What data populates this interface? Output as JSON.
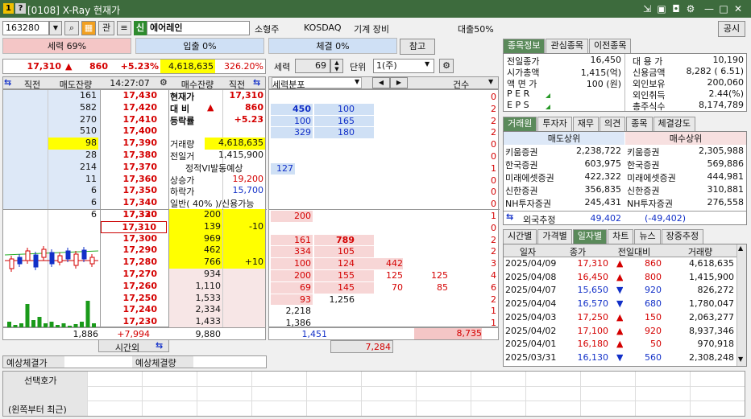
{
  "window": {
    "title": "[0108] X-Ray 현재가",
    "icon_num": "1",
    "icon_help": "?"
  },
  "toolbar": {
    "code": "163280",
    "btn_kwan": "관",
    "btn_sin": "신",
    "stock_name": "에어레인",
    "size": "소형주",
    "market": "KOSDAQ",
    "sector": "기계 장비",
    "loan": "대출50%",
    "notice": "공시"
  },
  "strength": {
    "label": "세력 69%",
    "in_label": "입출 0%",
    "trade_label": "체결 0%",
    "ref_btn": "참고"
  },
  "price_bar": {
    "price": "17,310",
    "arrow": "▲",
    "change": "860",
    "rate": "+5.23%",
    "volume": "4,618,635",
    "vol_rate": "326.20%"
  },
  "controls": {
    "force_label": "세력",
    "force_value": "69",
    "unit_label": "단위",
    "unit_value": "1(주)"
  },
  "orderbook_header": {
    "left_arrow": "⇆",
    "col1": "직전",
    "col2": "매도잔량",
    "time": "14:27:07",
    "col3": "매수잔량",
    "col4": "직전"
  },
  "ask_rows": [
    {
      "qty": "161",
      "price": "17,430"
    },
    {
      "qty": "582",
      "price": "17,420"
    },
    {
      "qty": "270",
      "price": "17,410"
    },
    {
      "qty": "510",
      "price": "17,400"
    },
    {
      "qty": "98",
      "price": "17,390"
    },
    {
      "qty": "28",
      "price": "17,380"
    },
    {
      "qty": "214",
      "price": "17,370"
    },
    {
      "qty": "11",
      "price": "17,360"
    },
    {
      "qty": "6",
      "price": "17,350"
    },
    {
      "qty": "6",
      "price": "17,340"
    },
    {
      "qty": "6",
      "price": "17,330"
    }
  ],
  "info_rows": [
    {
      "label": "현재가",
      "value": "17,310"
    },
    {
      "label": "대  비",
      "arrow": "▲",
      "value": "860"
    },
    {
      "label": "등락률",
      "value": "+5.23"
    },
    {
      "label": "",
      "value": ""
    },
    {
      "label": "거래량",
      "value": "4,618,635"
    },
    {
      "label": "전일거",
      "value": "1,415,900"
    },
    {
      "label": "정적VI발동예상",
      "value": ""
    },
    {
      "label": "상승가",
      "value": "19,200"
    },
    {
      "label": "하락가",
      "value": "15,700"
    },
    {
      "label": "일반( 40% )/신용가능",
      "value": ""
    }
  ],
  "bid_rows": [
    {
      "price": "17,320",
      "qty": "200",
      "prev": ""
    },
    {
      "price": "17,310",
      "qty": "139",
      "prev": "-10"
    },
    {
      "price": "17,300",
      "qty": "969",
      "prev": ""
    },
    {
      "price": "17,290",
      "qty": "462",
      "prev": ""
    },
    {
      "price": "17,280",
      "qty": "766",
      "prev": "+10"
    },
    {
      "price": "17,270",
      "qty": "934",
      "prev": ""
    },
    {
      "price": "17,260",
      "qty": "1,110",
      "prev": ""
    },
    {
      "price": "17,250",
      "qty": "1,533",
      "prev": ""
    },
    {
      "price": "17,240",
      "qty": "2,334",
      "prev": ""
    },
    {
      "price": "17,230",
      "qty": "1,433",
      "prev": ""
    }
  ],
  "orderbook_total": {
    "ask_total": "1,886",
    "diff": "+7,994",
    "bid_total": "9,880",
    "after_hours": "시간외"
  },
  "force_panel": {
    "header": "세력분포",
    "count_header": "건수",
    "ask_rows": [
      {
        "a": "",
        "b": "",
        "cnt": "0"
      },
      {
        "a": "450",
        "b": "100",
        "cnt": "2"
      },
      {
        "a": "100",
        "b": "165",
        "cnt": "2"
      },
      {
        "a": "329",
        "b": "180",
        "cnt": "2"
      },
      {
        "a": "",
        "b": "",
        "cnt": "0"
      },
      {
        "a": "",
        "b": "",
        "cnt": "0"
      },
      {
        "a": "127",
        "b": "",
        "cnt": "1"
      },
      {
        "a": "",
        "b": "",
        "cnt": "0"
      },
      {
        "a": "",
        "b": "",
        "cnt": "0"
      },
      {
        "a": "",
        "b": "",
        "cnt": "0"
      }
    ],
    "bid_rows": [
      {
        "a": "200",
        "b": "",
        "c": "",
        "d": "",
        "cnt": "1"
      },
      {
        "a": "",
        "b": "",
        "c": "",
        "d": "",
        "cnt": "0"
      },
      {
        "a": "161",
        "b": "789",
        "c": "",
        "d": "",
        "cnt": "2"
      },
      {
        "a": "334",
        "b": "105",
        "c": "",
        "d": "",
        "cnt": "2"
      },
      {
        "a": "100",
        "b": "124",
        "c": "442",
        "d": "",
        "cnt": "3"
      },
      {
        "a": "200",
        "b": "155",
        "c": "125",
        "d": "125",
        "cnt": "4"
      },
      {
        "a": "69",
        "b": "145",
        "c": "70",
        "d": "85",
        "cnt": "6"
      },
      {
        "a": "93",
        "b": "1,256",
        "c": "",
        "d": "",
        "cnt": "2"
      },
      {
        "a": "2,218",
        "b": "",
        "c": "",
        "d": "",
        "cnt": "1"
      },
      {
        "a": "1,386",
        "b": "",
        "c": "",
        "d": "",
        "cnt": "1"
      }
    ],
    "total_left": "1,451",
    "total_right": "8,735",
    "total_bottom": "7,284"
  },
  "expected": {
    "price_label": "예상체결가",
    "qty_label": "예상체결량"
  },
  "bottom": {
    "label1": "선택호가",
    "label2": "(왼쪽부터 최근)"
  },
  "right_tabs": [
    "종목정보",
    "관심종목",
    "이전종목"
  ],
  "stock_info": [
    {
      "l1": "전일종가",
      "v1": "16,450",
      "l2": "대 용 가",
      "v2": "10,190"
    },
    {
      "l1": "시가총액",
      "v1": "1,415(억)",
      "l2": "신용금액",
      "v2": "8,282  ( 6.51)"
    },
    {
      "l1": "액 면 가",
      "v1": "100 (원)",
      "l2": "외인보유",
      "v2": "200,060"
    },
    {
      "l1": "P E R",
      "v1": "",
      "l2": "외인취득",
      "v2": "2.44(%)"
    },
    {
      "l1": "E P S",
      "v1": "",
      "l2": "총주식수",
      "v2": "8,174,789"
    }
  ],
  "broker_tabs": [
    "거래원",
    "투자자",
    "재무",
    "의견",
    "종목",
    "체결강도"
  ],
  "broker": {
    "sell_header": "매도상위",
    "buy_header": "매수상위",
    "rows": [
      {
        "sn": "키움증권",
        "sv": "2,238,722",
        "bn": "키움증권",
        "bv": "2,305,988"
      },
      {
        "sn": "한국증권",
        "sv": "603,975",
        "bn": "한국증권",
        "bv": "569,886"
      },
      {
        "sn": "미래에셋증권",
        "sv": "422,322",
        "bn": "미래에셋증권",
        "bv": "444,981"
      },
      {
        "sn": "신한증권",
        "sv": "356,835",
        "bn": "신한증권",
        "bv": "310,881"
      },
      {
        "sn": "NH투자증권",
        "sv": "245,431",
        "bn": "NH투자증권",
        "bv": "276,558"
      }
    ],
    "foreign_label": "외국추정",
    "foreign_sell": "49,402",
    "foreign_buy": "(-49,402)"
  },
  "daily_tabs": [
    "시간별",
    "가격별",
    "일자별",
    "차트",
    "뉴스",
    "장중추정"
  ],
  "daily": {
    "headers": [
      "일자",
      "종가",
      "전일대비",
      "거래량"
    ],
    "rows": [
      {
        "date": "2025/04/09",
        "close": "17,310",
        "dir": "▲",
        "chg": "860",
        "vol": "4,618,635",
        "up": true
      },
      {
        "date": "2025/04/08",
        "close": "16,450",
        "dir": "▲",
        "chg": "800",
        "vol": "1,415,900",
        "up": true
      },
      {
        "date": "2025/04/07",
        "close": "15,650",
        "dir": "▼",
        "chg": "920",
        "vol": "826,272",
        "up": false
      },
      {
        "date": "2025/04/04",
        "close": "16,570",
        "dir": "▼",
        "chg": "680",
        "vol": "1,780,047",
        "up": false
      },
      {
        "date": "2025/04/03",
        "close": "17,250",
        "dir": "▲",
        "chg": "150",
        "vol": "2,063,277",
        "up": true
      },
      {
        "date": "2025/04/02",
        "close": "17,100",
        "dir": "▲",
        "chg": "920",
        "vol": "8,937,346",
        "up": true
      },
      {
        "date": "2025/04/01",
        "close": "16,180",
        "dir": "▲",
        "chg": "50",
        "vol": "970,918",
        "up": true
      },
      {
        "date": "2025/03/31",
        "close": "16,130",
        "dir": "▼",
        "chg": "560",
        "vol": "2,308,248",
        "up": false
      }
    ]
  },
  "colors": {
    "titlebar": "#3d6b3d",
    "up": "#d40000",
    "down": "#1230c8",
    "highlight": "#ffff00",
    "ask_bg": "#dde8f7",
    "bid_bg": "#f7e6e6"
  }
}
